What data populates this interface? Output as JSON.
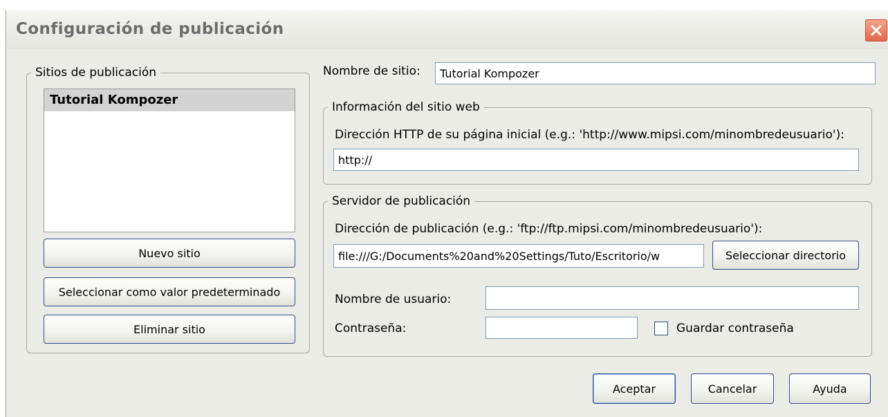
{
  "window": {
    "title": "Configuración de publicación"
  },
  "sites_panel": {
    "legend": "Sitios de publicación",
    "sites": [
      "Tutorial Kompozer"
    ],
    "new_site_button": "Nuevo sitio",
    "set_default_button": "Seleccionar como valor predeterminado",
    "delete_site_button": "Eliminar sitio"
  },
  "site_name": {
    "label": "Nombre de sitio:",
    "value": "Tutorial Kompozer"
  },
  "website_info": {
    "legend": "Información del sitio web",
    "http_label": "Dirección HTTP de su página inicial (e.g.: 'http://www.mipsi.com/minombredeusuario'):",
    "http_value": "http://"
  },
  "publish_server": {
    "legend": "Servidor de publicación",
    "publish_label": "Dirección de publicación (e.g.: 'ftp://ftp.mipsi.com/minombredeusuario'):",
    "publish_value": "file:///G:/Documents%20and%20Settings/Tuto/Escritorio/w",
    "select_dir_button": "Seleccionar directorio",
    "username_label": "Nombre de usuario:",
    "username_value": "",
    "password_label": "Contraseña:",
    "password_value": "",
    "save_password_label": "Guardar contraseña",
    "save_password_checked": false
  },
  "buttons": {
    "accept": "Aceptar",
    "cancel": "Cancelar",
    "help": "Ayuda"
  },
  "colors": {
    "dialog_bg": "#ecece6",
    "button_border": "#2d4c8c",
    "close_button": "#e0684c"
  }
}
